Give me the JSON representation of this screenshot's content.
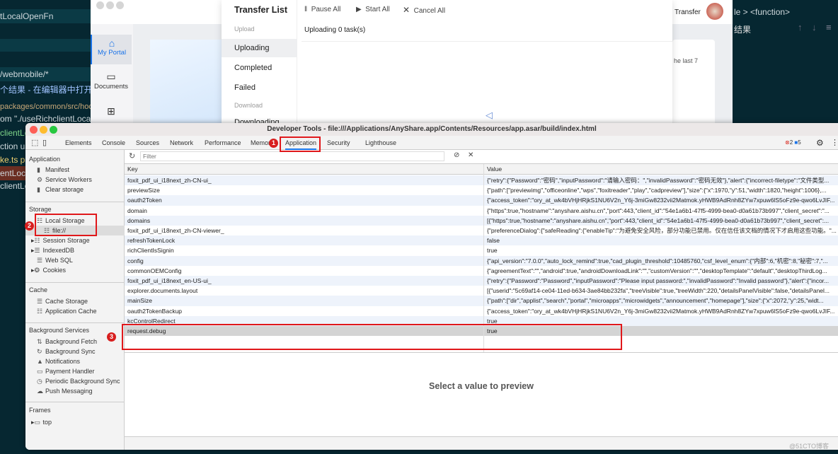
{
  "editor_left": {
    "lines": [
      "tLocalOpenFn",
      "/webmobile/*",
      "个结果 - 在编辑器中打开",
      "packages/common/src/hoo",
      "om \"./useRichclientLocal",
      "clientLo",
      "ction us",
      "ke.ts pa",
      "entLoca",
      "clientLo"
    ]
  },
  "editor_right": {
    "breadcrumb": "le > <function>",
    "results_label": "结果"
  },
  "anyshare": {
    "nav": [
      {
        "label": "My Portal"
      },
      {
        "label": "Documents"
      }
    ],
    "transfer_label": "Transfer",
    "card_text": "he last 7"
  },
  "transfer": {
    "title": "Transfer List",
    "sections": {
      "upload": "Upload",
      "download": "Download"
    },
    "items": [
      "Uploading",
      "Completed",
      "Failed",
      "Downloading"
    ],
    "actions": {
      "pause": "Pause All",
      "start": "Start All",
      "cancel": "Cancel All"
    },
    "status": "Uploading 0 task(s)"
  },
  "devtools": {
    "title": "Developer Tools - file:///Applications/AnyShare.app/Contents/Resources/app.asar/build/index.html",
    "tabs": [
      "Elements",
      "Console",
      "Sources",
      "Network",
      "Performance",
      "Memory",
      "Application",
      "Security",
      "Lighthouse"
    ],
    "active_tab": "Application",
    "errors": "2",
    "messages": "5",
    "filter_placeholder": "Filter",
    "sidebar": {
      "application": {
        "title": "Application",
        "items": [
          "Manifest",
          "Service Workers",
          "Clear storage"
        ]
      },
      "storage": {
        "title": "Storage",
        "items": [
          "Local Storage",
          "file://",
          "Session Storage",
          "IndexedDB",
          "Web SQL",
          "Cookies"
        ]
      },
      "cache": {
        "title": "Cache",
        "items": [
          "Cache Storage",
          "Application Cache"
        ]
      },
      "background": {
        "title": "Background Services",
        "items": [
          "Background Fetch",
          "Background Sync",
          "Notifications",
          "Payment Handler",
          "Periodic Background Sync",
          "Push Messaging"
        ]
      },
      "frames": {
        "title": "Frames",
        "items": [
          "top"
        ]
      }
    },
    "table": {
      "columns": [
        "Key",
        "Value"
      ],
      "rows": [
        {
          "key": "foxit_pdf_ui_i18next_zh-CN-ui_",
          "value": "{\"retry\":{\"Password\":\"密码\",\"inputPassword\":\"请输入密码：\",\"invalidPassword\":\"密码无效\"},\"alert\":{\"incorrect-filetype\":\"文件类型..."
        },
        {
          "key": "previewSize",
          "value": "{\"path\":[\"previewimg\",\"officeonline\",\"wps\",\"foxitreader\",\"play\",\"cadpreview\"],\"size\":{\"x\":1970,\"y\":51,\"width\":1820,\"height\":1006},..."
        },
        {
          "key": "oauth2Token",
          "value": "{\"access_token\":\"ory_at_wk4bVHjHRjkS1NU6V2n_Y6j-3miGw8232vii2Matmok.yHWB9AdRnh8ZYw7xpuw6lS5oFz9e-qwo6LvJIF..."
        },
        {
          "key": "domain",
          "value": "{\"https\":true,\"hostname\":\"anyshare.aishu.cn\",\"port\":443,\"client_id\":\"54e1a6b1-47f5-4999-bea0-d0a61b73b997\",\"client_secret\":\"..."
        },
        {
          "key": "domains",
          "value": "[{\"https\":true,\"hostname\":\"anyshare.aishu.cn\",\"port\":443,\"client_id\":\"54e1a6b1-47f5-4999-bea0-d0a61b73b997\",\"client_secret\":..."
        },
        {
          "key": "foxit_pdf_ui_i18next_zh-CN-viewer_",
          "value": "{\"preferenceDialog\":{\"safeReading\":{\"enableTip\":\"为避免安全风险，部分功能已禁用。仅在信任该文档的情况下才启用这些功能。\"..."
        },
        {
          "key": "refreshTokenLock",
          "value": "false"
        },
        {
          "key": "richClientIsSignin",
          "value": "true"
        },
        {
          "key": "config",
          "value": "{\"api_version\":\"7.0.0\",\"auto_lock_remind\":true,\"cad_plugin_threshold\":10485760,\"csf_level_enum\":{\"内部\":6,\"机密\":8,\"秘密\":7,\"..."
        },
        {
          "key": "commonOEMConfig",
          "value": "{\"agreementText\":\"\",\"android\":true,\"androidDownloadLink\":\"\",\"customVersion\":\"\",\"desktopTemplate\":\"default\",\"desktopThirdLog..."
        },
        {
          "key": "foxit_pdf_ui_i18next_en-US-ui_",
          "value": "{\"retry\":{\"Password\":\"Password\",\"inputPassword\":\"Please input password:\",\"invalidPassword\":\"Invalid password\"},\"alert\":{\"incor..."
        },
        {
          "key": "explorer.documents.layout",
          "value": "[{\"userid\":\"5c69af14-ce04-11ed-b634-3ae84bb232fa\",\"treeVisible\":true,\"treeWidth\":220,\"detailsPanelVisible\":false,\"detailsPanel..."
        },
        {
          "key": "mainSize",
          "value": "{\"path\":[\"dir\",\"applist\",\"search\",\"portal\",\"microapps\",\"microwidgets\",\"announcement\",\"homepage\"],\"size\":{\"x\":2072,\"y\":25,\"widt..."
        },
        {
          "key": "oauth2TokenBackup",
          "value": "{\"access_token\":\"ory_at_wk4bVHjHRjkS1NU6V2n_Y6j-3miGw8232vii2Matmok.yHWB9AdRnh8ZYw7xpuw6lS5oFz9e-qwo6LvJIF..."
        },
        {
          "key": "kcControlRedirect",
          "value": "true"
        },
        {
          "key": "request.debug",
          "value": "true",
          "selected": true
        }
      ]
    },
    "preview_text": "Select a value to preview"
  },
  "annotations": [
    "1",
    "2",
    "3"
  ],
  "watermark": "@51CTO博客",
  "colors": {
    "annotation": "#e0181b",
    "accent": "#1a73e8",
    "editor_bg": "#062731"
  }
}
